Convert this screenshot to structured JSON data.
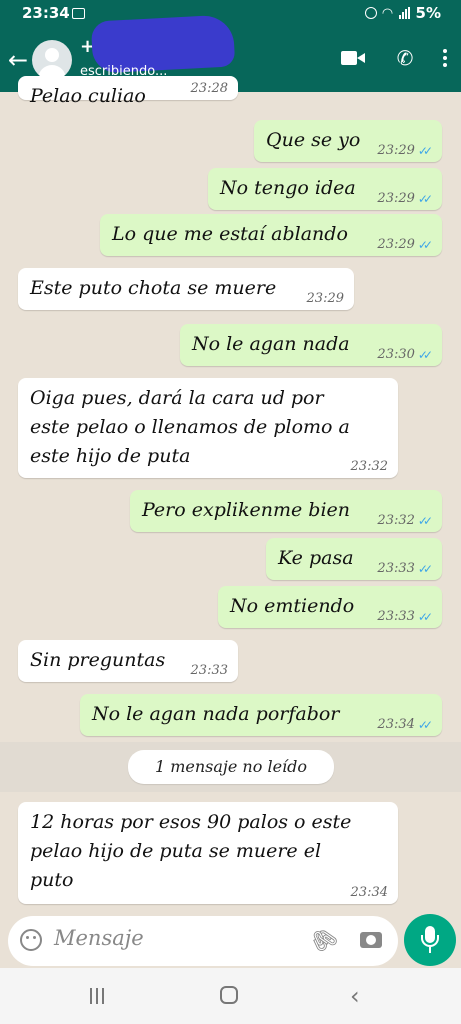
{
  "status_bar": {
    "time": "23:34",
    "battery": "5%"
  },
  "header": {
    "contact_name": "+",
    "status": "escribiendo...",
    "icons": [
      "back-arrow-icon",
      "avatar",
      "video-call-icon",
      "phone-icon",
      "more-options-icon"
    ]
  },
  "messages": [
    {
      "dir": "in",
      "lines": [
        "Pelao culiao"
      ],
      "time": "23:28"
    },
    {
      "dir": "out",
      "lines": [
        "Que se yo"
      ],
      "time": "23:29"
    },
    {
      "dir": "out",
      "lines": [
        "No tengo idea"
      ],
      "time": "23:29"
    },
    {
      "dir": "out",
      "lines": [
        "Lo que me estaí ablando"
      ],
      "time": "23:29"
    },
    {
      "dir": "in",
      "lines": [
        "Este puto chota se muere"
      ],
      "time": "23:29"
    },
    {
      "dir": "out",
      "lines": [
        "No le agan nada"
      ],
      "time": "23:30"
    },
    {
      "dir": "in",
      "lines": [
        "Oiga pues, dará la cara ud por",
        "este pelao o llenamos de plomo a",
        "este hijo de puta"
      ],
      "time": "23:32"
    },
    {
      "dir": "out",
      "lines": [
        "Pero explikenme bien"
      ],
      "time": "23:32"
    },
    {
      "dir": "out",
      "lines": [
        "Ke pasa"
      ],
      "time": "23:33"
    },
    {
      "dir": "out",
      "lines": [
        "No emtiendo"
      ],
      "time": "23:33"
    },
    {
      "dir": "in",
      "lines": [
        "Sin preguntas"
      ],
      "time": "23:33"
    },
    {
      "dir": "out",
      "lines": [
        "No le agan nada porfabor"
      ],
      "time": "23:34"
    },
    {
      "dir": "in",
      "lines": [
        "12 horas por esos 90 palos o este",
        "pelao hijo de puta se muere el",
        "puto"
      ],
      "time": "23:34"
    }
  ],
  "unread_banner": "1 mensaje no leído",
  "input": {
    "placeholder": "Mensaje"
  },
  "colors": {
    "header": "#07675a",
    "outgoing": "#dcf8c6",
    "incoming": "#ffffff",
    "mic": "#00a884",
    "read_ticks": "#3fa6e8"
  }
}
